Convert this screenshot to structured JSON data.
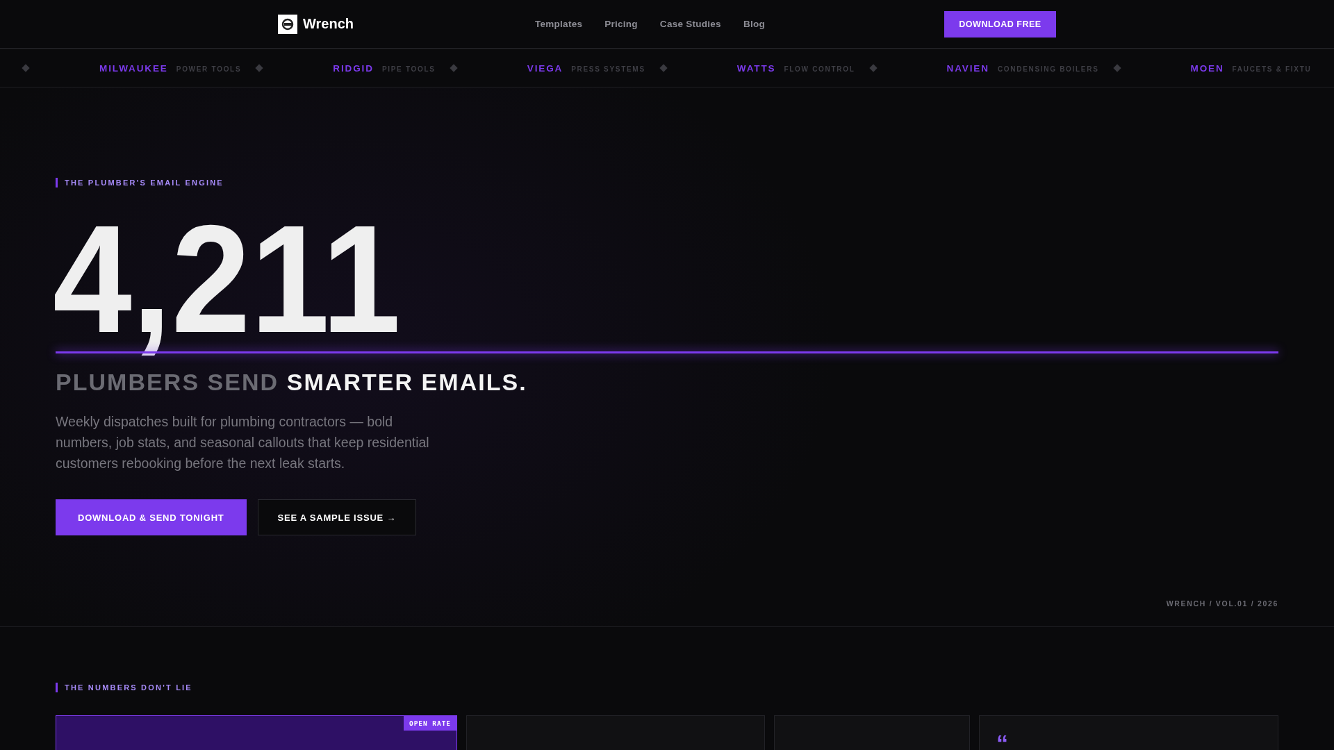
{
  "nav": {
    "brand": "Wrench",
    "links": [
      {
        "label": "Templates"
      },
      {
        "label": "Pricing"
      },
      {
        "label": "Case Studies"
      },
      {
        "label": "Blog"
      }
    ],
    "cta": "DOWNLOAD FREE"
  },
  "ticker": [
    {
      "brand": "MILWAUKEE",
      "category": "POWER TOOLS"
    },
    {
      "brand": "RIDGID",
      "category": "PIPE TOOLS"
    },
    {
      "brand": "VIEGA",
      "category": "PRESS SYSTEMS"
    },
    {
      "brand": "WATTS",
      "category": "FLOW CONTROL"
    },
    {
      "brand": "NAVIEN",
      "category": "CONDENSING BOILERS"
    },
    {
      "brand": "MOEN",
      "category": "FAUCETS & FIXTU"
    }
  ],
  "hero": {
    "eyebrow": "THE PLUMBER'S EMAIL ENGINE",
    "number": "4,211",
    "headline": "PLUMBERS SEND **SMARTER EMAILS.**",
    "description": "Weekly dispatches built for plumbing contractors — bold numbers, job stats, and seasonal callouts that keep residential customers rebooking before the next leak starts.",
    "buttons": [
      {
        "label": "DOWNLOAD & SEND TONIGHT",
        "kind": "primary"
      },
      {
        "label": "SEE A SAMPLE ISSUE →",
        "kind": "outline"
      }
    ],
    "issue_tag": "WRENCH / VOL.01 / 2026"
  },
  "stats": {
    "eyebrow": "THE NUMBERS DON'T LIE",
    "cards": [
      {
        "kind": "featured",
        "badge": "OPEN RATE"
      },
      {
        "kind": "plain"
      },
      {
        "kind": "plain"
      },
      {
        "kind": "quote",
        "mark": "“"
      }
    ]
  }
}
